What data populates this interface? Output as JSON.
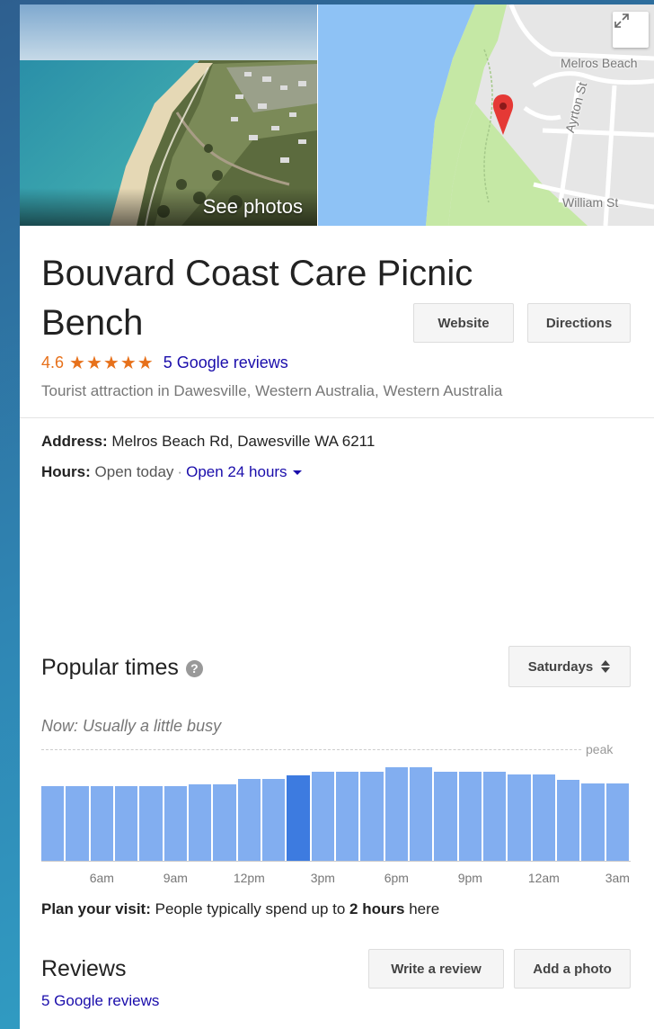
{
  "photo": {
    "see_photos": "See photos"
  },
  "map": {
    "labels": {
      "street1": "Melros Beach",
      "street2": "Ayrton St",
      "street3": "William St"
    },
    "colors": {
      "water": "#8ec2f5",
      "park": "#c5e8a5",
      "land": "#e6e6e6",
      "pin": "#e53935"
    }
  },
  "place": {
    "title": "Bouvard Coast Care Picnic Bench",
    "rating": "4.6",
    "stars": "★★★★★",
    "reviews_link": "5 Google reviews",
    "category": "Tourist attraction in Dawesville, Western Australia, Western Australia",
    "website_label": "Website",
    "directions_label": "Directions"
  },
  "info": {
    "address_label": "Address:",
    "address_value": "Melros Beach Rd, Dawesville WA 6211",
    "hours_label": "Hours:",
    "open_today": "Open today",
    "separator": "·",
    "hours_value": "Open 24 hours"
  },
  "popular": {
    "title": "Popular times",
    "help": "?",
    "day_select": "Saturdays",
    "now_text": "Now: Usually a little busy",
    "peak_label": "peak",
    "chart_data": {
      "type": "bar",
      "hours": [
        "4am",
        "5am",
        "6am",
        "7am",
        "8am",
        "9am",
        "10am",
        "11am",
        "12pm",
        "1pm",
        "2pm",
        "3pm",
        "4pm",
        "5pm",
        "6pm",
        "7pm",
        "8pm",
        "9pm",
        "10pm",
        "11pm",
        "12am",
        "1am",
        "2am",
        "3am"
      ],
      "values": [
        83,
        83,
        83,
        83,
        83,
        83,
        85,
        85,
        91,
        91,
        95,
        99,
        99,
        99,
        104,
        104,
        99,
        99,
        99,
        96,
        96,
        90,
        86,
        86
      ],
      "current_index": 10,
      "tick_labels": [
        "6am",
        "9am",
        "12pm",
        "3pm",
        "6pm",
        "9pm",
        "12am",
        "3am"
      ],
      "tick_indices": [
        2,
        5,
        8,
        11,
        14,
        17,
        20,
        23
      ],
      "ylim": [
        0,
        112
      ],
      "colors": {
        "bar": "#82aef0",
        "current": "#3d7be0"
      }
    },
    "plan_label": "Plan your visit:",
    "plan_text_1": "People typically spend up to",
    "plan_bold": "2 hours",
    "plan_text_2": "here"
  },
  "reviews": {
    "title": "Reviews",
    "write_label": "Write a review",
    "photo_label": "Add a photo",
    "link": "5 Google reviews"
  }
}
